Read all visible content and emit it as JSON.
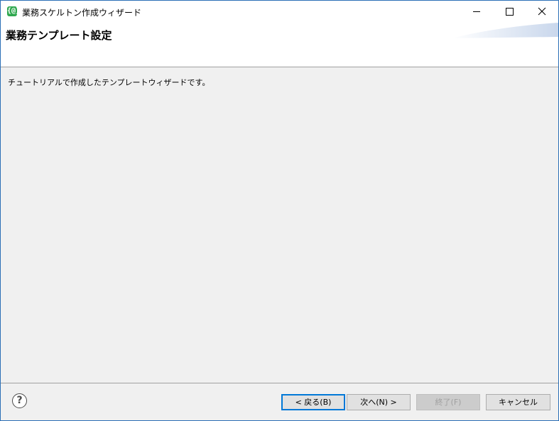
{
  "window": {
    "title": "業務スケルトン作成ウィザード",
    "app_icon_glyph": "{@}",
    "accent_color": "#2b6fb6"
  },
  "banner": {
    "title": "業務テンプレート設定"
  },
  "content": {
    "description": "チュートリアルで作成したテンプレートウィザードです。"
  },
  "footer": {
    "help_glyph": "?",
    "back_label": "< 戻る(B)",
    "next_label": "次へ(N) >",
    "finish_label": "終了(F)",
    "cancel_label": "キャンセル"
  }
}
